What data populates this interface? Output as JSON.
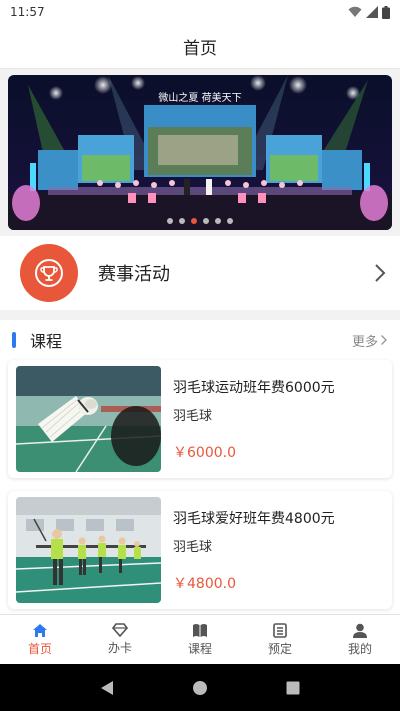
{
  "status_bar": {
    "time": "11:57"
  },
  "header": {
    "title": "首页"
  },
  "banner": {
    "slogan": "微山之夏 荷美天下",
    "dots": 6,
    "active_dot": 2
  },
  "events": {
    "label": "赛事活动",
    "icon": "trophy-icon"
  },
  "courses": {
    "title": "课程",
    "more": "更多",
    "items": [
      {
        "title": "羽毛球运动班年费6000元",
        "category": "羽毛球",
        "price": "￥6000.0"
      },
      {
        "title": "羽毛球爱好班年费4800元",
        "category": "羽毛球",
        "price": "￥4800.0"
      }
    ]
  },
  "tabbar": {
    "items": [
      {
        "label": "首页",
        "icon": "home-icon",
        "active": true
      },
      {
        "label": "办卡",
        "icon": "diamond-icon",
        "active": false
      },
      {
        "label": "课程",
        "icon": "book-icon",
        "active": false
      },
      {
        "label": "预定",
        "icon": "list-icon",
        "active": false
      },
      {
        "label": "我的",
        "icon": "person-icon",
        "active": false
      }
    ]
  },
  "colors": {
    "accent": "#e8573a",
    "section_bar": "#2d7af0"
  }
}
